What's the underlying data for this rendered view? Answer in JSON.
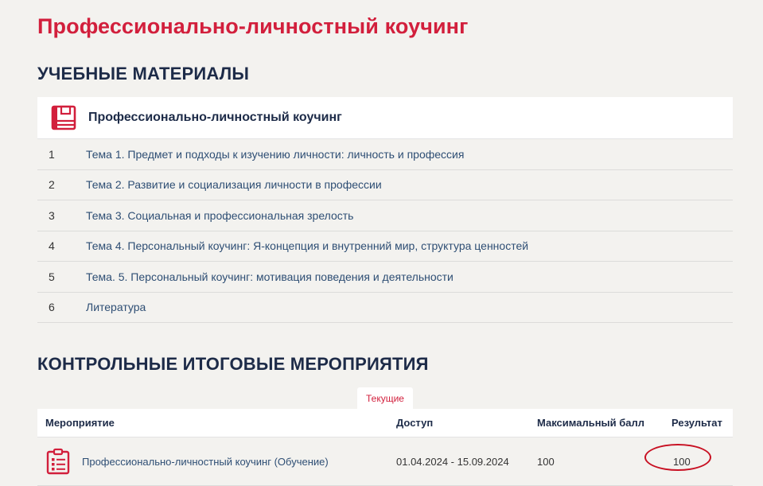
{
  "page_title": "Профессионально-личностный коучинг",
  "materials_section": {
    "title": "УЧЕБНЫЕ МАТЕРИАЛЫ",
    "course_title": "Профессионально-личностный коучинг",
    "course_icon": "book-icon",
    "items": [
      {
        "num": "1",
        "label": "Тема 1. Предмет и подходы к изучению личности: личность и профессия"
      },
      {
        "num": "2",
        "label": "Тема 2. Развитие и социализация личности в профессии"
      },
      {
        "num": "3",
        "label": "Тема 3. Социальная и профессиональная зрелость"
      },
      {
        "num": "4",
        "label": "Тема 4. Персональный коучинг: Я-концепция и внутренний мир, структура ценностей"
      },
      {
        "num": "5",
        "label": "Тема. 5. Персональный коучинг: мотивация поведения и деятельности"
      },
      {
        "num": "6",
        "label": "Литература"
      }
    ]
  },
  "events_section": {
    "title": "КОНТРОЛЬНЫЕ ИТОГОВЫЕ МЕРОПРИЯТИЯ",
    "tab_label": "Текущие",
    "columns": [
      "Мероприятие",
      "Доступ",
      "Максимальный балл",
      "Результат"
    ],
    "rows": [
      {
        "icon": "clipboard-list-icon",
        "event": "Профессионально-личностный коучинг (Обучение)",
        "access": "01.04.2024 - 15.09.2024",
        "max_score": "100",
        "result": "100"
      }
    ]
  },
  "colors": {
    "accent": "#d21f3c",
    "heading": "#1d2b48",
    "link": "#2e4e74",
    "background": "#f3f2ef",
    "highlight_oval": "#c81022"
  }
}
